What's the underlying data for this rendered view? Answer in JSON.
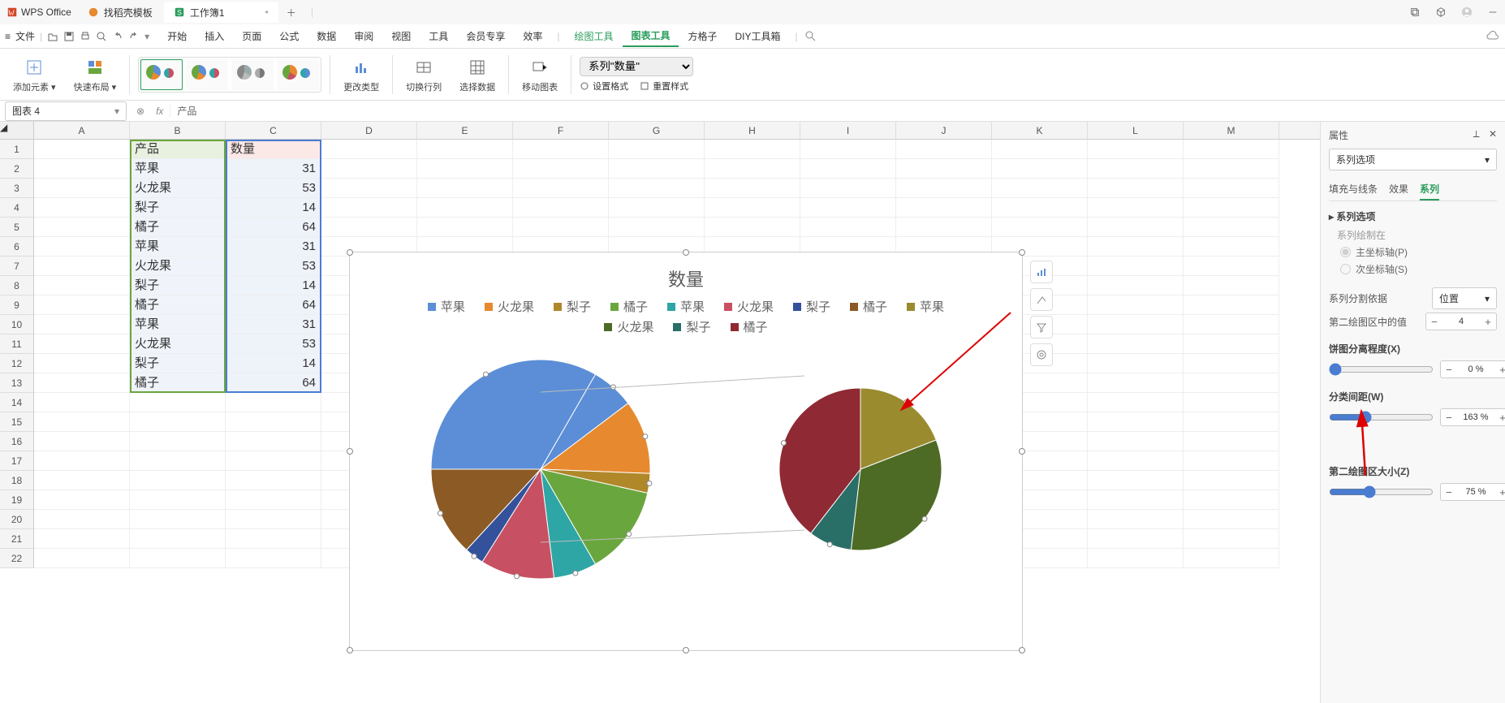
{
  "app": {
    "name": "WPS Office"
  },
  "window_tabs": [
    {
      "label": "找稻壳模板",
      "kind": "template"
    },
    {
      "label": "工作簿1",
      "kind": "sheet",
      "active": true
    }
  ],
  "quick_access": {
    "file": "文件"
  },
  "menus": [
    "开始",
    "插入",
    "页面",
    "公式",
    "数据",
    "审阅",
    "视图",
    "工具",
    "会员专享",
    "效率"
  ],
  "context_menus": {
    "draw": "绘图工具",
    "chart": "图表工具",
    "fgz": "方格子",
    "diy": "DIY工具箱"
  },
  "ribbon": {
    "add_element": "添加元素",
    "quick_layout": "快速布局",
    "change_type": "更改类型",
    "switch_rc": "切换行列",
    "select_data": "选择数据",
    "move_chart": "移动图表",
    "series_dropdown": "系列\"数量\"",
    "set_format": "设置格式",
    "reset_style": "重置样式"
  },
  "name_box": "图表 4",
  "formula_text": "产品",
  "columns": [
    "A",
    "B",
    "C",
    "D",
    "E",
    "F",
    "G",
    "H",
    "I",
    "J",
    "K",
    "L",
    "M"
  ],
  "table": {
    "headers": {
      "b": "产品",
      "c": "数量"
    },
    "rows": [
      {
        "b": "苹果",
        "c": 31
      },
      {
        "b": "火龙果",
        "c": 53
      },
      {
        "b": "梨子",
        "c": 14
      },
      {
        "b": "橘子",
        "c": 64
      },
      {
        "b": "苹果",
        "c": 31
      },
      {
        "b": "火龙果",
        "c": 53
      },
      {
        "b": "梨子",
        "c": 14
      },
      {
        "b": "橘子",
        "c": 64
      },
      {
        "b": "苹果",
        "c": 31
      },
      {
        "b": "火龙果",
        "c": 53
      },
      {
        "b": "梨子",
        "c": 14
      },
      {
        "b": "橘子",
        "c": 64
      }
    ]
  },
  "chart_data": {
    "type": "pie",
    "title": "数量",
    "series_name": "数量",
    "categories": [
      "苹果",
      "火龙果",
      "梨子",
      "橘子",
      "苹果",
      "火龙果",
      "梨子",
      "橘子",
      "苹果",
      "火龙果",
      "梨子",
      "橘子"
    ],
    "values": [
      31,
      53,
      14,
      64,
      31,
      53,
      14,
      64,
      31,
      53,
      14,
      64
    ],
    "colors": [
      "#5b8ed6",
      "#e7892f",
      "#b0882a",
      "#6aa63e",
      "#2ea6a5",
      "#c85063",
      "#34529b",
      "#8c5a25",
      "#9a8b2f",
      "#4d6b24",
      "#296e67",
      "#8f2a34"
    ],
    "subplot": {
      "type": "pie-of-pie",
      "second_plot_count": 4
    }
  },
  "prop": {
    "title": "属性",
    "dropdown": "系列选项",
    "tabs": {
      "fill": "填充与线条",
      "effect": "效果",
      "series": "系列"
    },
    "series_section": "系列选项",
    "draw_at": "系列绘制在",
    "primary_axis": "主坐标轴(P)",
    "secondary_axis": "次坐标轴(S)",
    "split_label": "系列分割依据",
    "split_value": "位置",
    "secondplot_label": "第二绘图区中的值",
    "secondplot_value": 4,
    "explode_label": "饼图分离程度(X)",
    "explode_value": "0 %",
    "gap_label": "分类间距(W)",
    "gap_value": "163 %",
    "secondsize_label": "第二绘图区大小(Z)",
    "secondsize_value": "75 %"
  }
}
